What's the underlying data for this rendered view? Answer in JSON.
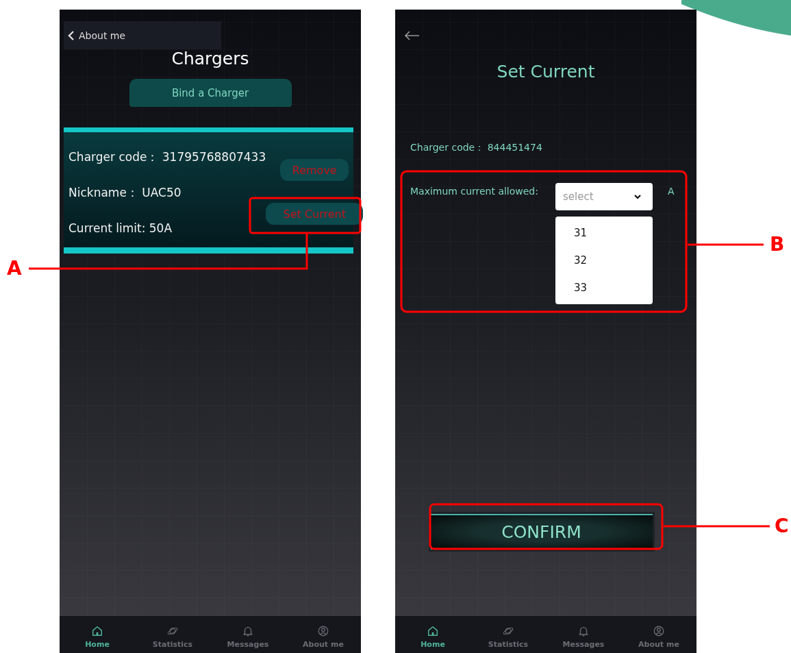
{
  "screens": [
    {
      "kind": "chargers",
      "back": {
        "label": "About me"
      },
      "title": "Chargers",
      "bind_button": "Bind a Charger",
      "charger": {
        "fields": [
          {
            "label": "Charger code：",
            "value": "31795768807433"
          },
          {
            "label": "Nickname：",
            "value": "UAC50"
          },
          {
            "label": "Current limit:",
            "value": "50A"
          }
        ],
        "buttons": [
          "Remove",
          "Set Current"
        ]
      },
      "tabs": [
        {
          "label": "Home",
          "selected": true
        },
        {
          "label": "Statistics",
          "selected": false
        },
        {
          "label": "Messages",
          "selected": false
        },
        {
          "label": "About me",
          "selected": false
        }
      ]
    },
    {
      "kind": "set_current",
      "title": "Set Current",
      "charger_code": {
        "label": "Charger code：",
        "value": "844451474"
      },
      "max_current": {
        "label": "Maximum current allowed:",
        "placeholder": "select",
        "unit": "A",
        "options": [
          "31",
          "32",
          "33"
        ]
      },
      "confirm": "CONFIRM",
      "tabs": [
        {
          "label": "Home",
          "selected": true
        },
        {
          "label": "Statistics",
          "selected": false
        },
        {
          "label": "Messages",
          "selected": false
        },
        {
          "label": "About me",
          "selected": false
        }
      ]
    }
  ],
  "callouts": [
    {
      "label": "A"
    },
    {
      "label": "B"
    },
    {
      "label": "C"
    }
  ]
}
